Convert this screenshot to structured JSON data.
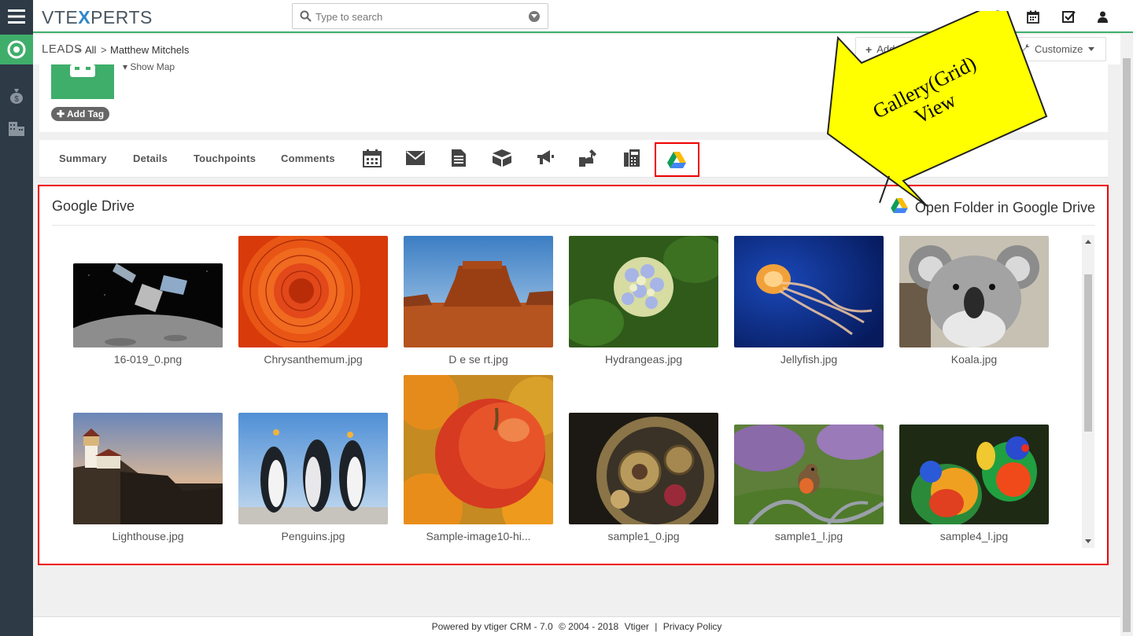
{
  "app": {
    "logo_prefix": "VTE",
    "logo_x": "X",
    "logo_suffix": "PERTS",
    "accent_color": "#3fae6b",
    "sidebar_color": "#2e3a46"
  },
  "search": {
    "placeholder": "Type to search"
  },
  "breadcrumb": {
    "module": "LEADS",
    "filter": "All",
    "record": "Matthew Mitchels"
  },
  "header_actions": {
    "add_lead": "Add Lead",
    "customize": "Customize"
  },
  "record_header": {
    "show_map": "▾ Show Map",
    "add_tag": "Add Tag"
  },
  "tabs": {
    "summary": "Summary",
    "details": "Details",
    "touchpoints": "Touchpoints",
    "comments": "Comments",
    "icons": [
      "calendar-icon",
      "email-icon",
      "document-icon",
      "box-icon",
      "megaphone-icon",
      "support-icon",
      "phone-icon",
      "google-drive-icon"
    ]
  },
  "google_drive": {
    "title": "Google Drive",
    "open_folder": "Open Folder in Google Drive",
    "files": [
      {
        "name": "16-019_0.png",
        "image": "spacecraft over moon"
      },
      {
        "name": "Chrysanthemum.jpg",
        "image": "orange flower"
      },
      {
        "name": "D e se rt.jpg",
        "image": "desert butte"
      },
      {
        "name": "Hydrangeas.jpg",
        "image": "hydrangea flowers"
      },
      {
        "name": "Jellyfish.jpg",
        "image": "jellyfish"
      },
      {
        "name": "Koala.jpg",
        "image": "koala"
      },
      {
        "name": "Lighthouse.jpg",
        "image": "lighthouse on cliff"
      },
      {
        "name": "Penguins.jpg",
        "image": "penguins"
      },
      {
        "name": "Sample-image10-hi...",
        "image": "apple"
      },
      {
        "name": "sample1_0.jpg",
        "image": "clockwork"
      },
      {
        "name": "sample1_l.jpg",
        "image": "robin bird"
      },
      {
        "name": "sample4_l.jpg",
        "image": "parrots"
      }
    ]
  },
  "callout": {
    "line1": "Gallery(Grid)",
    "line2": "View",
    "color": "#ffff00"
  },
  "footer": {
    "powered": "Powered by vtiger CRM - 7.0",
    "copyright": "© 2004 - 2018",
    "vtiger": "Vtiger",
    "sep": "|",
    "privacy": "Privacy Policy"
  }
}
